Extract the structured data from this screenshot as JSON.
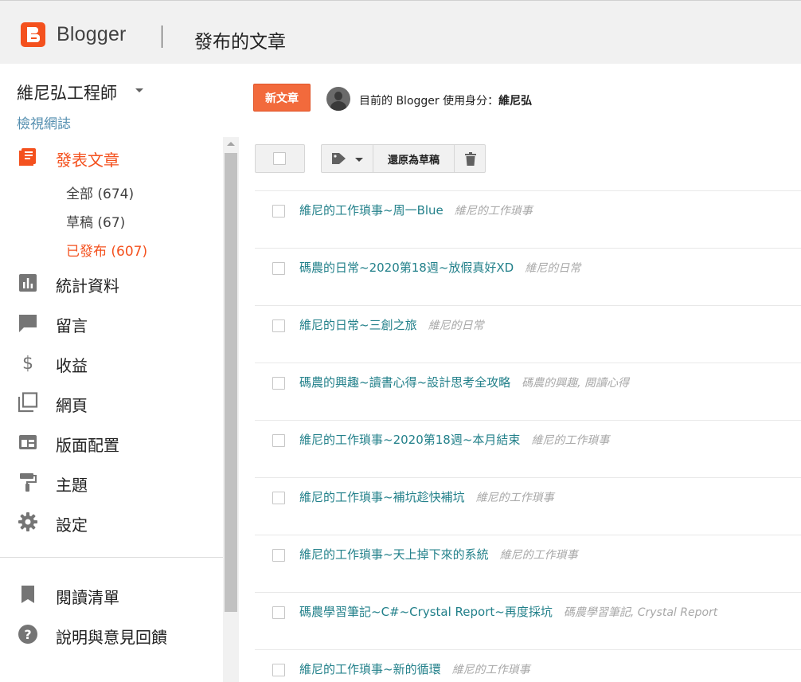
{
  "header": {
    "logo_text": "Blogger",
    "page_title": "發布的文章"
  },
  "sidebar": {
    "blog_name": "維尼弘工程師",
    "view_blog": "檢視網誌",
    "posts": {
      "label": "發表文章",
      "sub": [
        {
          "label": "全部 (674)"
        },
        {
          "label": "草稿 (67)"
        },
        {
          "label": "已發布 (607)"
        }
      ]
    },
    "items": [
      {
        "label": "統計資料",
        "icon": "stats-icon"
      },
      {
        "label": "留言",
        "icon": "comment-icon"
      },
      {
        "label": "收益",
        "icon": "dollar-icon"
      },
      {
        "label": "網頁",
        "icon": "pages-icon"
      },
      {
        "label": "版面配置",
        "icon": "layout-icon"
      },
      {
        "label": "主題",
        "icon": "theme-icon"
      },
      {
        "label": "設定",
        "icon": "gear-icon"
      }
    ],
    "bottom_items": [
      {
        "label": "閱讀清單",
        "icon": "bookmark-icon"
      },
      {
        "label": "說明與意見回饋",
        "icon": "help-icon"
      }
    ]
  },
  "main": {
    "new_post_label": "新文章",
    "identity_prefix": "目前的 Blogger 使用身分：",
    "identity_name": "維尼弘",
    "revert_label": "還原為草稿",
    "posts": [
      {
        "title": "維尼的工作瑣事~周一Blue",
        "labels": "維尼的工作瑣事"
      },
      {
        "title": "碼農的日常~2020第18週~放假真好XD",
        "labels": "維尼的日常"
      },
      {
        "title": "維尼的日常~三創之旅",
        "labels": "維尼的日常"
      },
      {
        "title": "碼農的興趣~讀書心得~設計思考全攻略",
        "labels": "碼農的興趣, 閱讀心得"
      },
      {
        "title": "維尼的工作瑣事~2020第18週~本月結束",
        "labels": "維尼的工作瑣事"
      },
      {
        "title": "維尼的工作瑣事~補坑趁快補坑",
        "labels": "維尼的工作瑣事"
      },
      {
        "title": "維尼的工作瑣事~天上掉下來的系統",
        "labels": "維尼的工作瑣事"
      },
      {
        "title": "碼農學習筆記~C#~Crystal Report~再度採坑",
        "labels": "碼農學習筆記, Crystal Report"
      },
      {
        "title": "維尼的工作瑣事~新的循環",
        "labels": "維尼的工作瑣事"
      }
    ]
  },
  "colors": {
    "accent": "#f4511e",
    "link": "#22808a",
    "label": "#a8a8a8"
  }
}
